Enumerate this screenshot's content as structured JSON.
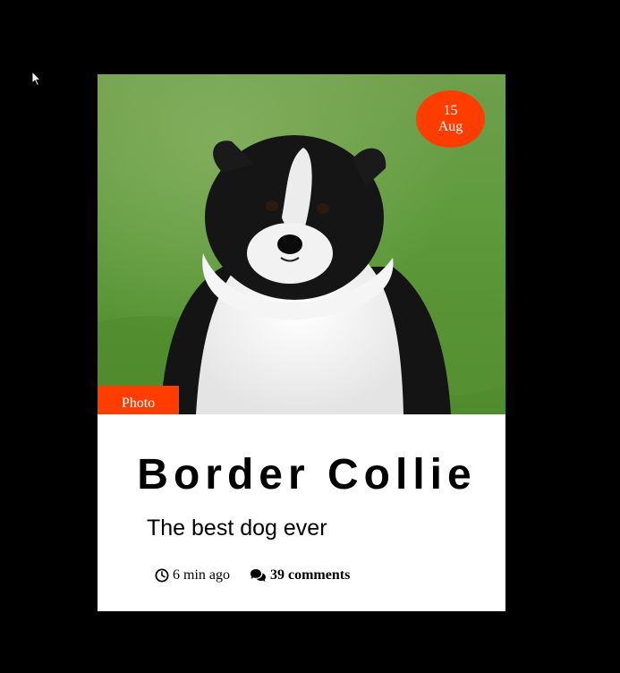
{
  "colors": {
    "accent": "#ff3d00",
    "background": "#000000",
    "card": "#ffffff"
  },
  "card": {
    "image": {
      "subject": "border-collie-puppy-photo"
    },
    "date": {
      "day": "15",
      "month": "Aug"
    },
    "tag": "Photo",
    "title": "Border Collie",
    "subtitle": "The best dog ever",
    "meta": {
      "time_icon": "clock-icon",
      "time": "6 min ago",
      "comments_icon": "comments-icon",
      "comments": "39 comments"
    }
  }
}
